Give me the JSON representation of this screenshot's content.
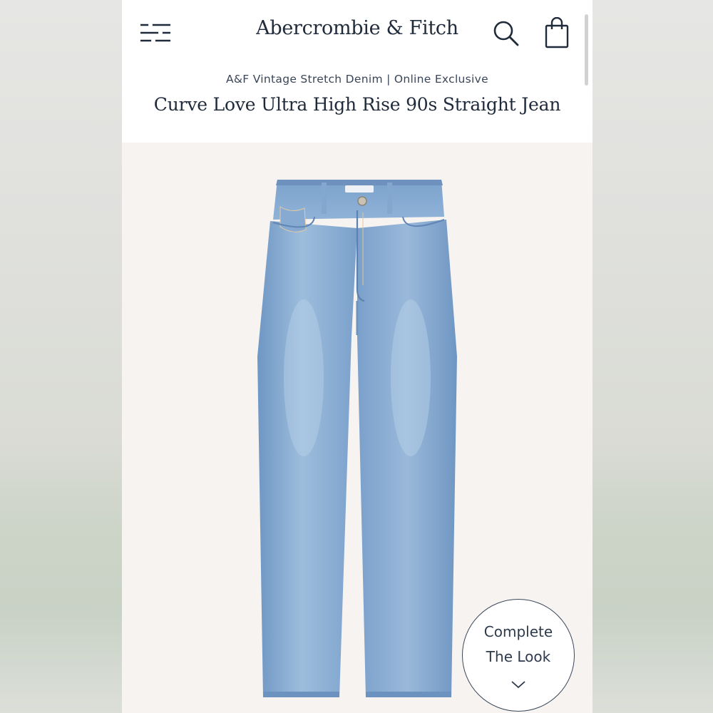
{
  "header": {
    "logo_text": "Abercrombie & Fitch",
    "menu_icon": "hamburger-menu-icon",
    "search_icon": "search-icon",
    "bag_icon": "shopping-bag-icon"
  },
  "product": {
    "collection": "A&F Vintage Stretch Denim | Online Exclusive",
    "title": "Curve Love Ultra High Rise 90s Straight Jean",
    "image": "light-wash-straight-jeans"
  },
  "complete_look": {
    "line1": "Complete",
    "line2": "The Look",
    "icon": "chevron-down-icon"
  },
  "colors": {
    "brand_navy": "#1f2a3a",
    "denim_light": "#8eb1d6",
    "denim_mid": "#6f97c4",
    "background": "#f6f3f1"
  }
}
